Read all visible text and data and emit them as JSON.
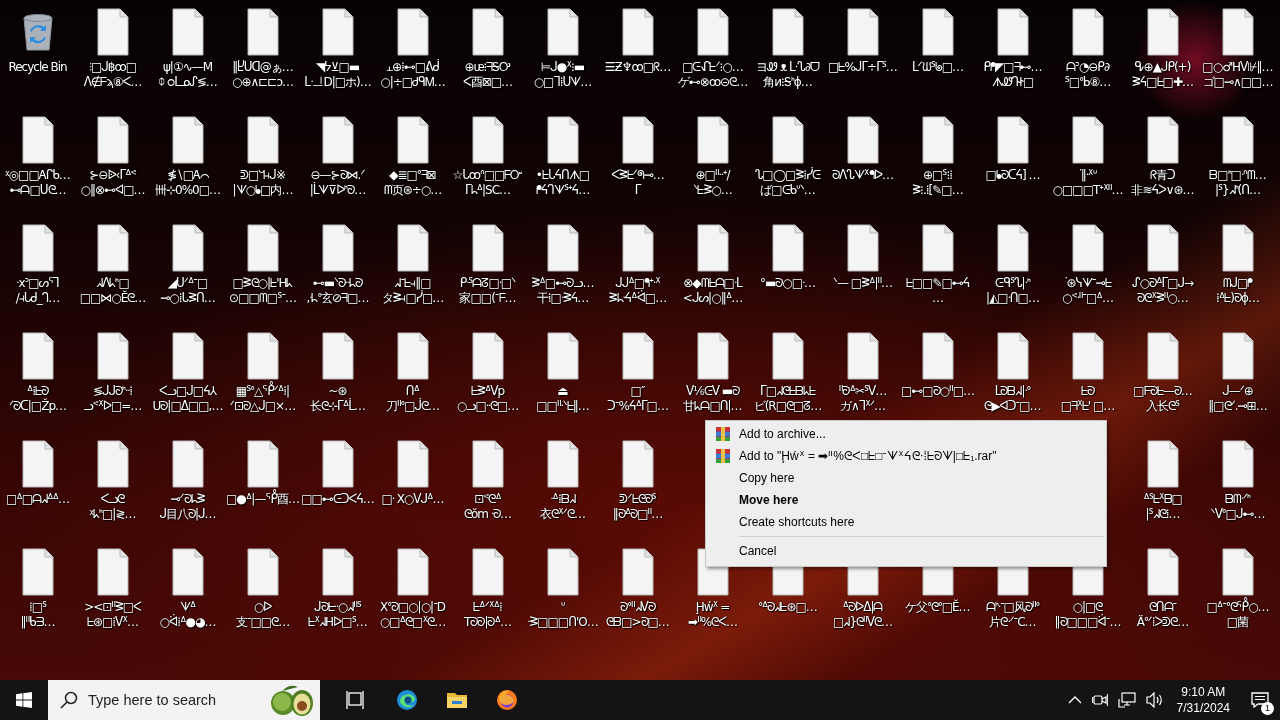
{
  "desktop": {
    "icon_rows": [
      {
        "icons": [
          {
            "kind": "recycle",
            "label": "Recycle Bin"
          },
          {
            "kind": "file",
            "label": "⫶□ᒍ฿ꝏ□\nᐱ∉ᖴϡ⑧ᐸ…"
          },
          {
            "kind": "file",
            "label": "ψ|①∿—M\nᛰ ᴑᒪᓄᔑ≶…"
          },
          {
            "kind": "file",
            "label": "‖Ⴞᑌᗡ@ぁ…\n○⊕∧⊏⊏ᴐ…"
          },
          {
            "kind": "file",
            "label": "◥ᔭ⊻□▬\nᒷᆜD|□ホ)…"
          },
          {
            "kind": "file",
            "label": "⫠⊕⁞⊷□ᕕᑰ\n○|÷□ᏧᑫᎷ…"
          },
          {
            "kind": "file",
            "label": "⊕ᵫ⁝ᖷᎦᎤ\nᐸ酉⊠□…"
          },
          {
            "kind": "file",
            "label": "⊨ᒍ●ᕽ⁝▬\n○□ᒣ⁞ᑌᗐ…"
          },
          {
            "kind": "file",
            "label": "☰Ƶ♆ꝏ□ᖇ…"
          },
          {
            "kind": "file",
            "label": "□ᕮᖋᖶᐟ⁝○…\nゲ⊷⊗ꝏ⊝ᘓ…"
          },
          {
            "kind": "file",
            "label": "ヨᏪ ᴥ ᒪᔗ∂ᗜ\n角ᴎ⁝Ꭶᑋϕ…"
          },
          {
            "kind": "file",
            "label": "□ᖶ%ᒍᒥ÷ᒥᔆ…"
          },
          {
            "kind": "file",
            "label": "ᒪᐟᙎᔆᖚ□…"
          },
          {
            "kind": "file",
            "label": "ᑭᖰ◤□ᖷ⊷…\nᗑᏪᒉᏐ□"
          },
          {
            "kind": "file",
            "label": "ᗩᐣ◔⊖ᑭ∂\nᔆ□ᐤᖯ⑧…"
          },
          {
            "kind": "file",
            "label": "ᕴ⊕▲ᒍᑭ(+)\nᕒᔦ□ᖶ□✚…"
          },
          {
            "kind": "file",
            "label": "□○♂Hᐯ⊮‖…\nゴ□⊸∧□□…"
          }
        ]
      },
      {
        "icons": [
          {
            "kind": "file",
            "label": "ᵡ◎□□Ꭺᒋᑲ…\n⊷ᗩ□ᑌᘓ…"
          },
          {
            "kind": "file",
            "label": "⊱⊖ᐉ‹ᒥᐞᕝ\n○‖⊗⊷ᐊ□…"
          },
          {
            "kind": "file",
            "label": "≸∖□Ꭺ⌒\n卌⊹0%0□…"
          },
          {
            "kind": "file",
            "label": "ᕲ□ᖻ⫞ᒍ※\n|ᗐ○ᖲ□内…"
          },
          {
            "kind": "file",
            "label": "⊖—⊱ᘐ⋈.ᐟ\n|ᒫᗐ⊽ᐅᑋᘐ…"
          },
          {
            "kind": "file",
            "label": "◆≣□ᐤᖷ⊠\nᗰ页⊛÷○…"
          },
          {
            "kind": "file",
            "label": "☆ᒐꝏᐢ□□ᖴᏅ\nᒥᖺᐞ|SC…"
          },
          {
            "kind": "file",
            "label": "•ᖶᒐᔦᑎᗑ□\nᖰᔦᒉᗐᔆᐩᔦ…"
          },
          {
            "kind": "file",
            "label": "ᐸᕒᖶᐟᖗ⊸…\nᒥ"
          },
          {
            "kind": "file",
            "label": "⊕□ᐦᐧᐧᐩ/\nᐠᖶᕒ○…"
          },
          {
            "kind": "file",
            "label": "ᔐ□◯□ᕒ⁞ᓰᕮ\nば□ᕮᑲᐡᐠ…"
          },
          {
            "kind": "file",
            "label": "ᘐᐱᔐᗐᕽᖳᐅ…"
          },
          {
            "kind": "file",
            "label": "⊕□ᔆ⁝⁞\nᕒ⁝.⁞[✎□…"
          },
          {
            "kind": "file",
            "label": "□ᖲᘐᑕᔦ] …"
          },
          {
            "kind": "file",
            "label": "ᐝ‖ᐧᕽᐡ\n○□□□Tᐩᕽᐦ…"
          },
          {
            "kind": "file",
            "label": "ᖇ青ᑐ\n非≋ᔦᐳ∨⊛…"
          },
          {
            "kind": "file",
            "label": "ᗷ□ᑋ□ᐧᐢᗰ…\n|ᔆ}ᖽᑋ(ᑎ…"
          }
        ]
      },
      {
        "icons": [
          {
            "kind": "file",
            "label": "ᐧxᐣ□ᔕᕐᒣ\n/⫞ᒐᑯ_ᒉ…"
          },
          {
            "kind": "file",
            "label": "ᖽᐱᖾᑋ□\n□□⋈○Ĕᘓ…"
          },
          {
            "kind": "file",
            "label": "◢ᑌᐟᐞᐨ□\n⊸○⁞ᒐᕒᑎ…"
          },
          {
            "kind": "file",
            "label": "□ᕒᘓ○|ᖶ'Hᖾ\n⊙□□ᗰ□ᔆᐨ…"
          },
          {
            "kind": "file",
            "label": "⊷▬ᐠᘐᐧᐧᖺᘐ\n,ᐧᖺᐤ玄⊘ᖷ□…"
          },
          {
            "kind": "file",
            "label": "ᖽᐨᖶ⫞‖□\nタᕒ⫞□ᓰ□…"
          },
          {
            "kind": "file",
            "label": "ᑭᐧᔆᗩᘔ□ᐧ□ᐠ\n家□□(ᐨᖴ…"
          },
          {
            "kind": "file",
            "label": "ᕒᐞ□⊷ᘐᓗ…\n干⁞□ᐧᕒᔦ…"
          },
          {
            "kind": "file",
            "label": "ᒍᒍᐞ□ᖳᐩᐧᕽ\nᕒᖺᐧᔦᐞᐛ□…"
          },
          {
            "kind": "file",
            "label": "⊗◆ᗰᖶᗩ□ᐧᒪ\n<ᒍᔕ|○‖ᐞ…"
          },
          {
            "kind": "file",
            "label": "°▬ᘐ○□ᐧ…"
          },
          {
            "kind": "file",
            "label": "ᐠ— □ᕒᐞ|ᐦ…"
          },
          {
            "kind": "file",
            "label": "ᖶ□□✎□⊷ᔦ…"
          },
          {
            "kind": "file",
            "label": "ᕮᑫᔆᔐ|ᐧᑋ\n|◭□ᐧᑎ□…"
          },
          {
            "kind": "file",
            "label": "ᐝ⊛ᓭᗐᐨ⊸ᖶ\n○ᕝᐧᐦᐨ□ᐞ…"
          },
          {
            "kind": "file",
            "label": "ᔑ○ᘐᐞᒥ□ᒍ→\nᘐᘓᕽᕒᐦ○…"
          },
          {
            "kind": "file",
            "label": "ᗰᒍ□ᖰ\n⁞ᐞᖶ)ᘐϕ…"
          }
        ]
      },
      {
        "icons": [
          {
            "kind": "file",
            "label": "ᐞ⁞ᖶᘐ\nᐟᘐᑕ|□Žp…"
          },
          {
            "kind": "file",
            "label": "≶ᒍᒍᘐᑋᐧᐧ⁞\nᓗᕝᕽᐅ□=…"
          },
          {
            "kind": "file",
            "label": "ᐸᓗ□ᒍ□ᔦ⅄\nUᘐ|□ᐃ□□,…"
          },
          {
            "kind": "file",
            "label": "▦ᔆᐤ△ᕾᐟᐞ⁞|\nᐟ⊡ᘐ△ᒍ□×…"
          },
          {
            "kind": "file",
            "label": "~⊛\n长ᘓ⊹ᒥᐞᒫ…"
          },
          {
            "kind": "file",
            "label": "ᑎᐞ\n刀ᐦᐤ□ᒎᘓ…"
          },
          {
            "kind": "file",
            "label": "ᖶᕒᐞᐯp\n○ᓗ□ᐧᐧᘓ□…"
          },
          {
            "kind": "file",
            "label": "⏏\n□□ᐦᐧᐠᖶ‖…"
          },
          {
            "kind": "file",
            "label": "□″\nᑐᐨ%ᔦᐞᒥ□…"
          },
          {
            "kind": "file",
            "label": "ᐯ⅙ᕮᐯ ▬ᘐ\n甘ᖾᗩ□ᑎ|…"
          },
          {
            "kind": "file",
            "label": "ᒥ□ᖽᘓᖶᗷᖾᖶ\nビ(R□ᘓ□ᘔ…"
          },
          {
            "kind": "file",
            "label": "ᐦᘐᐞ✂ᔆᐯ…\nガ∧ᒣᕽᐟ…"
          },
          {
            "kind": "file",
            "label": "□⊷□ᘐ○ᐦ□…"
          },
          {
            "kind": "file",
            "label": "ᒪᘐᗷᖽ|ᐧᐤ\nᘓ▶ᐊᑐᐨ□…"
          },
          {
            "kind": "file",
            "label": "ᖶᘐ\n□ᖷᕽᖶ' □…"
          },
          {
            "kind": "file",
            "label": "□ᖴᘐᖶ—ᘐ…\n入长ᘓᔆ"
          },
          {
            "kind": "file",
            "label": "ᒍ—ᐟ⊕\n‖□ᘓᐟ.⊸⊞…"
          }
        ]
      },
      {
        "icons": [
          {
            "kind": "file",
            "label": "□ᐞ□ᗩᖽᐞᐞ…"
          },
          {
            "kind": "file",
            "label": "ᐸᓗᘓ\nᵡᖾᑋ□|≷…"
          },
          {
            "kind": "file",
            "label": "⊸ᐟᘐᖺᕒ\nᒍ目八ᘐ|ᒍ…"
          },
          {
            "kind": "file",
            "label": "□●ᐞ|—ᕾ酉…"
          },
          {
            "kind": "file",
            "label": "□□⊷ᕮᑐᐸᔦ…"
          },
          {
            "kind": "file",
            "label": "□ᐧ X○ᐯᒍᐞ…"
          },
          {
            "kind": "file",
            "label": "⊡ᕝᘓᐞ\nᘓŏm ᐧᘐ…"
          },
          {
            "kind": "file",
            "label": "ᐧᐞ⁞ᗷᖽ\n衣ᘓᕽᐟᘓ…"
          },
          {
            "kind": "file",
            "label": "ᕲᐟᖶᘓᘐᔆ\n‖ᘐᐞᘐ□ᐦ…"
          }
        ],
        "icons_after_menu": [
          {
            "kind": "file",
            "label": "ᐞᔆᖶᕽᗷ□\n|ᔆᖽᘓ⁞…"
          },
          {
            "kind": "file",
            "label": "ᗷᗰᐧᐟᑋ\nᐠᐯᐤ□ᒍ⊷…"
          }
        ]
      },
      {
        "icons": [
          {
            "kind": "file",
            "label": "⁞□ᔆ\n‖ᐦᑲᗱ…"
          },
          {
            "kind": "file",
            "label": "><⊡ᐦᕒ□ᐸ\nᖶ⊛□⁞ᐯᕽ…"
          },
          {
            "kind": "file",
            "label": "ᗐᐞ\n○ᐛ⁞ᐞ●◕…"
          },
          {
            "kind": "file",
            "label": "○ᐅ\n支ᐨ□□ᘓ…"
          },
          {
            "kind": "file",
            "label": "ᒍᘐᖶᐧᐧ○ᖽᐦᔆ\nᖶᕽᖽHᐅ□ᔆ…"
          },
          {
            "kind": "file",
            "label": "Xᐤᘐ□○|○|ᐨD\n○□ᐞᘓ□ᕽᘓ…"
          },
          {
            "kind": "file",
            "label": "ᖶᐞᐟᕽᐞ⁞\nTᘐᘐ|ᘐᐞ…"
          },
          {
            "kind": "file",
            "label": "ᐡ\nᐧᕒ□□□ᑎ'O…"
          },
          {
            "kind": "file",
            "label": "ᘐᐤᐦᖽᐯᘐ\nᘓᗷ□>ᘐ□…"
          },
          {
            "kind": "file",
            "label": "Ḩẃᕽ =\n➡ᐦ%ᘓᐸ…"
          },
          {
            "kind": "file",
            "label": "ᐤᐞᘐᖽᖶ⊛□…"
          },
          {
            "kind": "file",
            "label": "ᐞᘐᐅᐃ|ᗩ\n□ᖽ}ᘓᐦᐯᘓ…"
          },
          {
            "kind": "file",
            "label": "ケ父ᐤᘓᐤ□Ĕ…"
          },
          {
            "kind": "file",
            "label": "ᗩᑋᐧᐨ□风ᘐᐦᐤ\n片ᘓᐧᐟᐨC…"
          },
          {
            "kind": "file",
            "label": "○|□ᘓ\n‖ᘐ□□□ᐛᐨ…"
          },
          {
            "kind": "file",
            "label": "ᘓᑎᗩᐨ\nÄᐤᐟ⁞ᐳᕲᘓ…"
          },
          {
            "kind": "file",
            "label": "□ᐞᐨᐤᘓᕾ○…\n□菌"
          }
        ]
      }
    ]
  },
  "context_menu": {
    "items": [
      {
        "kind": "archive",
        "label": "Add to archive..."
      },
      {
        "kind": "archive",
        "label": "Add to \"Ḩẃᕽ = ➡ᐦ%ᘓᐸ□ᖶ□ᐨᗐᕽᔦᘓᐧ⁞ᖶᘐᗐ|□ᖶ₁.rar\""
      },
      {
        "kind": "plain",
        "label": "Copy here"
      },
      {
        "kind": "default",
        "label": "Move here"
      },
      {
        "kind": "plain",
        "label": "Create shortcuts here"
      },
      {
        "kind": "separator"
      },
      {
        "kind": "plain",
        "label": "Cancel"
      }
    ]
  },
  "taskbar": {
    "search": {
      "placeholder": "Type here to search"
    },
    "pinned": [
      {
        "kind": "taskview"
      },
      {
        "kind": "edge"
      },
      {
        "kind": "explorer"
      },
      {
        "kind": "firefox"
      }
    ],
    "clock": {
      "time": "9:10 AM",
      "date": "7/31/2024"
    },
    "notifications": {
      "count": "1"
    }
  }
}
